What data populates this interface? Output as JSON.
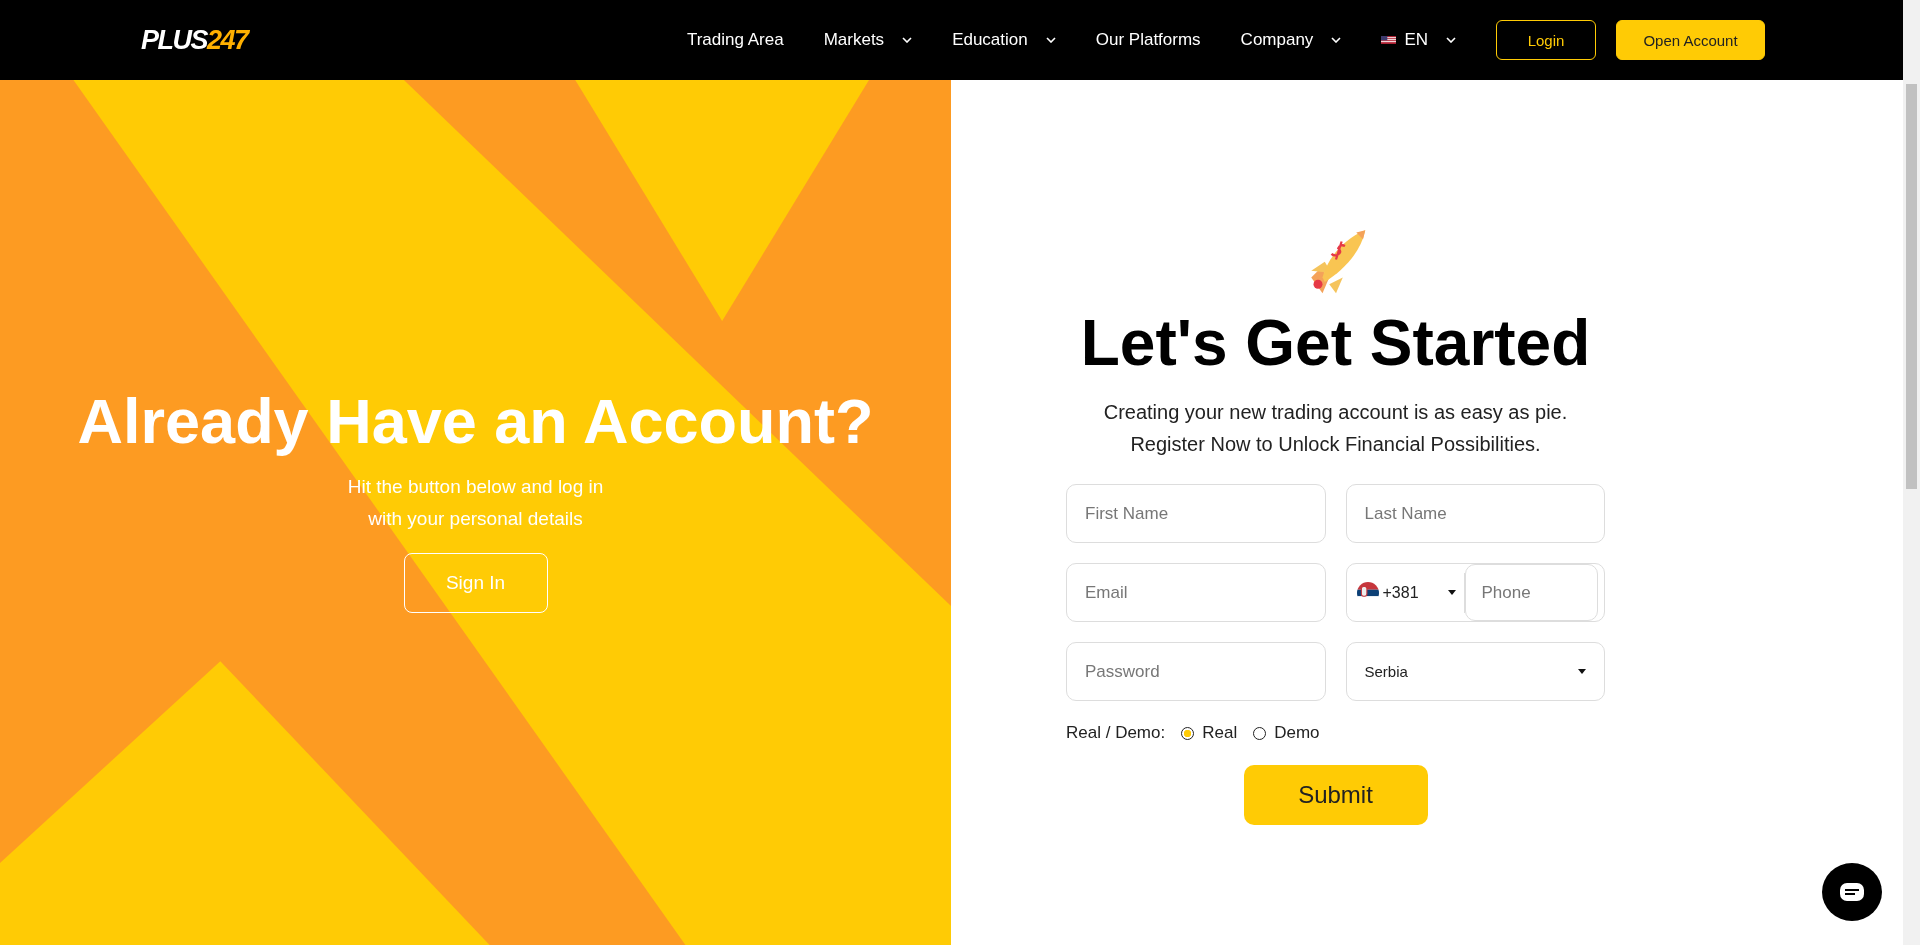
{
  "header": {
    "logo": {
      "part_1": "PLUS",
      "part_2": "247"
    },
    "nav": [
      {
        "label": "Trading Area",
        "dropdown": false
      },
      {
        "label": "Markets",
        "dropdown": true
      },
      {
        "label": "Education",
        "dropdown": true
      },
      {
        "label": "Our Platforms",
        "dropdown": false
      },
      {
        "label": "Company",
        "dropdown": true
      }
    ],
    "language": {
      "label": "EN",
      "dropdown": true
    },
    "buttons": [
      {
        "label": "Login",
        "kind": "outline"
      },
      {
        "label": "Open Account",
        "kind": "filled"
      }
    ]
  },
  "login_panel": {
    "title": "Already Have an Account?",
    "lines": [
      "Hit the button below and log in",
      "with your personal details"
    ],
    "button": "Sign In"
  },
  "register": {
    "title": "Let's Get Started",
    "lines": [
      "Creating your new trading account is as easy as pie.",
      "Register Now to Unlock Financial Possibilities."
    ],
    "fields": [
      {
        "kind": "text",
        "placeholder": "First Name"
      },
      {
        "kind": "text",
        "placeholder": "Last Name"
      },
      {
        "kind": "text",
        "placeholder": "Email"
      },
      {
        "kind": "phone",
        "code": "+381",
        "placeholder": "Phone"
      },
      {
        "kind": "password",
        "placeholder": "Password"
      },
      {
        "kind": "select",
        "value": "Serbia"
      }
    ],
    "account_type": {
      "label": "Real / Demo:",
      "options": [
        {
          "label": "Real",
          "selected": true
        },
        {
          "label": "Demo",
          "selected": false
        }
      ]
    },
    "submit": "Submit"
  }
}
